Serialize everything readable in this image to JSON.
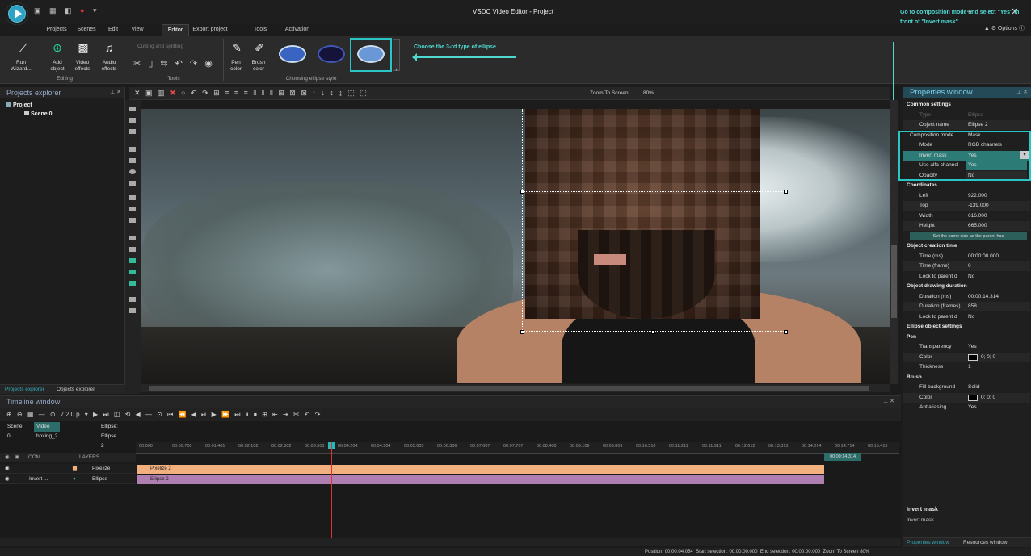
{
  "window": {
    "title": "VSDC Video Editor - Project",
    "options_label": "Options"
  },
  "menu": {
    "tabs": [
      "Projects",
      "Scenes",
      "Edit",
      "View",
      "Editor",
      "Export project",
      "Tools",
      "Activation"
    ],
    "active": "Editor"
  },
  "ribbon": {
    "run_wizard": "Run\nWizard...",
    "add_object": "Add\nobject",
    "video_effects": "Video\neffects",
    "audio_effects": "Audio\neffects",
    "editing_group": "Editing",
    "cutting_splitting": "Cutting and splitting",
    "tools_group": "Tools",
    "pen_color": "Pen\ncolor",
    "brush_color": "Brush\ncolor",
    "ellipse_style_group": "Choosing ellipse style"
  },
  "hints": {
    "choose_ellipse": "Choose the 3-rd type of ellipse",
    "composition_mode": "Go to composition mode and select \"Yes\" in front of \"Invert mask\""
  },
  "explorer": {
    "title": "Projects explorer",
    "project": "Project",
    "scene": "Scene 0",
    "tabs": [
      "Projects explorer",
      "Objects explorer"
    ]
  },
  "preview": {
    "zoom_label": "Zoom To Screen",
    "zoom_value": "80%"
  },
  "properties": {
    "title": "Properties window",
    "rows": [
      {
        "k": "Common settings",
        "v": "",
        "type": "sec"
      },
      {
        "k": "Type",
        "v": "Ellipse",
        "type": "dim"
      },
      {
        "k": "Object name",
        "v": "Ellipse 2",
        "type": "alt"
      },
      {
        "k": "Composition mode",
        "v": "Mask",
        "type": "sub"
      },
      {
        "k": "Mode",
        "v": "RGB channels",
        "type": ""
      },
      {
        "k": "Invert mask",
        "v": "Yes",
        "type": "sel"
      },
      {
        "k": "Use alfa channel",
        "v": "Yes",
        "type": "opt"
      },
      {
        "k": "Opacity",
        "v": "No",
        "type": "opt"
      },
      {
        "k": "Coordinates",
        "v": "",
        "type": "sec"
      },
      {
        "k": "Left",
        "v": "922.000",
        "type": ""
      },
      {
        "k": "Top",
        "v": "-139.000",
        "type": "alt"
      },
      {
        "k": "Width",
        "v": "616.000",
        "type": ""
      },
      {
        "k": "Height",
        "v": "665.000",
        "type": "alt"
      },
      {
        "k": "Set the same size as the parent has",
        "v": "",
        "type": "btn"
      },
      {
        "k": "Object creation time",
        "v": "",
        "type": "sec"
      },
      {
        "k": "Time (ms)",
        "v": "00:00:00.000",
        "type": ""
      },
      {
        "k": "Time (frame)",
        "v": "0",
        "type": "alt"
      },
      {
        "k": "Lock to parent d",
        "v": "No",
        "type": ""
      },
      {
        "k": "Object drawing duration",
        "v": "",
        "type": "sec"
      },
      {
        "k": "Duration (ms)",
        "v": "00:00:14.314",
        "type": ""
      },
      {
        "k": "Duration (frames)",
        "v": "858",
        "type": "alt"
      },
      {
        "k": "Lock to parent d",
        "v": "No",
        "type": ""
      },
      {
        "k": "Ellipse object settings",
        "v": "",
        "type": "sec"
      },
      {
        "k": "Pen",
        "v": "",
        "type": "sec"
      },
      {
        "k": "Transparency",
        "v": "Yes",
        "type": ""
      },
      {
        "k": "Color",
        "v": "0; 0; 0",
        "type": "alt"
      },
      {
        "k": "Thickness",
        "v": "1",
        "type": ""
      },
      {
        "k": "Brush",
        "v": "",
        "type": "sec"
      },
      {
        "k": "Fill background",
        "v": "Solid",
        "type": ""
      },
      {
        "k": "Color",
        "v": "0; 0; 0",
        "type": "alt"
      },
      {
        "k": "Antialiasing",
        "v": "Yes",
        "type": ""
      }
    ],
    "desc_title": "Invert mask",
    "desc_text": "Invert mask",
    "tabs": [
      "Properties window",
      "Resources window"
    ]
  },
  "timeline": {
    "title": "Timeline window",
    "resolution": "720p",
    "tabs": [
      "Scene 0",
      "Video boxing_2",
      "Ellipse: Ellipse 2"
    ],
    "ruler": [
      "00:000",
      "00:00.700",
      "00:01.401",
      "00:02.102",
      "00:02.802",
      "00:03.503",
      "00:04.204",
      "00:04.904",
      "00:05.605",
      "00:06.306",
      "00:07.007",
      "00:07.707",
      "00:08.408",
      "00:09.109",
      "00:09.809",
      "00:10.510",
      "00:11.211",
      "00:11.911",
      "00:12.612",
      "00:13.313",
      "00:14.014",
      "00:14.714",
      "00:15.415"
    ],
    "header_com": "COM...",
    "header_layers": "LAYERS",
    "layers": [
      {
        "mode": "",
        "name": "Pixelize",
        "clip": "Pixelize 2",
        "color": "#f2b07e"
      },
      {
        "mode": "Invert ...",
        "name": "Ellipse",
        "clip": "Ellipse 2",
        "color": "#b07fb2"
      }
    ],
    "end_time": "00:00:14.314"
  },
  "status": {
    "position": "Position:",
    "position_val": "00:00:04.054",
    "start_sel": "Start selection:",
    "start_sel_val": "00:00:00.000",
    "end_sel": "End selection:",
    "end_sel_val": "00:00:00.000",
    "zoom": "Zoom To Screen",
    "zoom_val": "80%"
  }
}
